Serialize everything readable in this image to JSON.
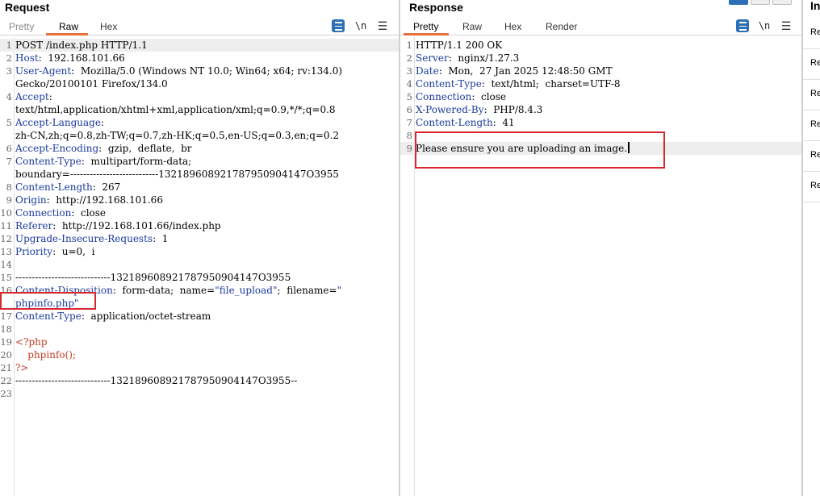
{
  "request": {
    "title": "Request",
    "tabs": [
      "Pretty",
      "Raw",
      "Hex"
    ],
    "active_tab": "Raw",
    "newline_label": "\\n",
    "lines": [
      {
        "n": "1",
        "parts": [
          {
            "t": "POST /index.php HTTP/1.1",
            "c": "v"
          }
        ]
      },
      {
        "n": "2",
        "parts": [
          {
            "t": "Host",
            "c": "k"
          },
          {
            "t": ":  192.168.101.66",
            "c": "v"
          }
        ]
      },
      {
        "n": "3",
        "parts": [
          {
            "t": "User-Agent",
            "c": "k"
          },
          {
            "t": ":  Mozilla/5.0 (Windows NT 10.0; Win64; x64; rv:134.0)",
            "c": "v"
          }
        ]
      },
      {
        "n": "",
        "parts": [
          {
            "t": "Gecko/20100101 Firefox/134.0",
            "c": "v"
          }
        ]
      },
      {
        "n": "4",
        "parts": [
          {
            "t": "Accept",
            "c": "k"
          },
          {
            "t": ":",
            "c": "v"
          }
        ]
      },
      {
        "n": "",
        "parts": [
          {
            "t": "text/html,application/xhtml+xml,application/xml;q=0.9,*/*;q=0.8",
            "c": "v"
          }
        ]
      },
      {
        "n": "5",
        "parts": [
          {
            "t": "Accept-Language",
            "c": "k"
          },
          {
            "t": ":",
            "c": "v"
          }
        ]
      },
      {
        "n": "",
        "parts": [
          {
            "t": "zh-CN,zh;q=0.8,zh-TW;q=0.7,zh-HK;q=0.5,en-US;q=0.3,en;q=0.2",
            "c": "v"
          }
        ]
      },
      {
        "n": "6",
        "parts": [
          {
            "t": "Accept-Encoding",
            "c": "k"
          },
          {
            "t": ":  gzip,  deflate,  br",
            "c": "v"
          }
        ]
      },
      {
        "n": "7",
        "parts": [
          {
            "t": "Content-Type",
            "c": "k"
          },
          {
            "t": ":  multipart/form-data;",
            "c": "v"
          }
        ]
      },
      {
        "n": "",
        "parts": [
          {
            "t": "boundary=---------------------------132189608921787950904147O3955",
            "c": "v"
          }
        ]
      },
      {
        "n": "8",
        "parts": [
          {
            "t": "Content-Length",
            "c": "k"
          },
          {
            "t": ":  267",
            "c": "v"
          }
        ]
      },
      {
        "n": "9",
        "parts": [
          {
            "t": "Origin",
            "c": "k"
          },
          {
            "t": ":  http://192.168.101.66",
            "c": "v"
          }
        ]
      },
      {
        "n": "10",
        "parts": [
          {
            "t": "Connection",
            "c": "k"
          },
          {
            "t": ":  close",
            "c": "v"
          }
        ]
      },
      {
        "n": "11",
        "parts": [
          {
            "t": "Referer",
            "c": "k"
          },
          {
            "t": ":  http://192.168.101.66/index.php",
            "c": "v"
          }
        ]
      },
      {
        "n": "12",
        "parts": [
          {
            "t": "Upgrade-Insecure-Requests",
            "c": "k"
          },
          {
            "t": ":  1",
            "c": "v"
          }
        ]
      },
      {
        "n": "13",
        "parts": [
          {
            "t": "Priority",
            "c": "k"
          },
          {
            "t": ":  u=0,  i",
            "c": "v"
          }
        ]
      },
      {
        "n": "14",
        "parts": []
      },
      {
        "n": "15",
        "parts": [
          {
            "t": "-----------------------------132189608921787950904147O3955",
            "c": "v"
          }
        ]
      },
      {
        "n": "16",
        "parts": [
          {
            "t": "Content-Disposition",
            "c": "k"
          },
          {
            "t": ":  form-data;  name=",
            "c": "v"
          },
          {
            "t": "\"file_upload\"",
            "c": "s"
          },
          {
            "t": ";  filename=",
            "c": "v"
          },
          {
            "t": "\"",
            "c": "s"
          }
        ]
      },
      {
        "n": "",
        "parts": [
          {
            "t": "phpinfo.php",
            "c": "s"
          },
          {
            "t": "\"",
            "c": "s"
          }
        ]
      },
      {
        "n": "17",
        "parts": [
          {
            "t": "Content-Type",
            "c": "k"
          },
          {
            "t": ":  application/octet-stream",
            "c": "v"
          }
        ]
      },
      {
        "n": "18",
        "parts": []
      },
      {
        "n": "19",
        "parts": [
          {
            "t": "<?php",
            "c": "php"
          }
        ]
      },
      {
        "n": "20",
        "parts": [
          {
            "t": "    phpinfo();",
            "c": "php"
          }
        ]
      },
      {
        "n": "21",
        "parts": [
          {
            "t": "?>",
            "c": "php"
          }
        ]
      },
      {
        "n": "22",
        "parts": [
          {
            "t": "-----------------------------132189608921787950904147O3955--",
            "c": "v"
          }
        ]
      },
      {
        "n": "23",
        "parts": []
      }
    ]
  },
  "response": {
    "title": "Response",
    "tabs": [
      "Pretty",
      "Raw",
      "Hex",
      "Render"
    ],
    "active_tab": "Pretty",
    "newline_label": "\\n",
    "lines": [
      {
        "n": "1",
        "parts": [
          {
            "t": "HTTP/1.1 200 OK",
            "c": "v"
          }
        ]
      },
      {
        "n": "2",
        "parts": [
          {
            "t": "Server",
            "c": "k"
          },
          {
            "t": ":  nginx/1.27.3",
            "c": "v"
          }
        ]
      },
      {
        "n": "3",
        "parts": [
          {
            "t": "Date",
            "c": "k"
          },
          {
            "t": ":  Mon,  27 Jan 2025 12:48:50 GMT",
            "c": "v"
          }
        ]
      },
      {
        "n": "4",
        "parts": [
          {
            "t": "Content-Type",
            "c": "k"
          },
          {
            "t": ":  text/html;  charset=UTF-8",
            "c": "v"
          }
        ]
      },
      {
        "n": "5",
        "parts": [
          {
            "t": "Connection",
            "c": "k"
          },
          {
            "t": ":  close",
            "c": "v"
          }
        ]
      },
      {
        "n": "6",
        "parts": [
          {
            "t": "X-Powered-By",
            "c": "k"
          },
          {
            "t": ":  PHP/8.4.3",
            "c": "v"
          }
        ]
      },
      {
        "n": "7",
        "parts": [
          {
            "t": "Content-Length",
            "c": "k"
          },
          {
            "t": ":  41",
            "c": "v"
          }
        ]
      },
      {
        "n": "8",
        "parts": []
      },
      {
        "n": "9",
        "parts": [
          {
            "t": "Please ensure you are uploading an image.",
            "c": "v"
          }
        ]
      }
    ]
  },
  "side": {
    "title": "In",
    "items": [
      "Re",
      "Re",
      "Re",
      "Re",
      "Re",
      "Re"
    ]
  },
  "colors": {
    "accent_tab": "#e8703a",
    "header_name": "#1a3a9c",
    "php_code": "#c23b22",
    "annotation": "#d8282f"
  },
  "icons": [
    "word-wrap-icon",
    "newline-icon",
    "menu-icon",
    "layout-toggle-icon"
  ]
}
